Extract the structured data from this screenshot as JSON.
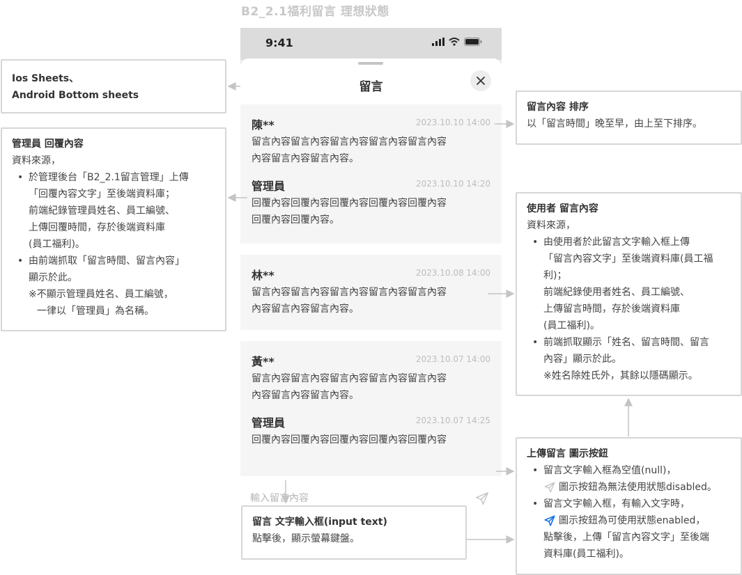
{
  "page_title": "B2_2.1福利留言 理想狀態",
  "status_bar": {
    "time": "9:41"
  },
  "sheet": {
    "title": "留言",
    "close_icon": "close-icon"
  },
  "messages": [
    {
      "name": "陳**",
      "time": "2023.10.10 14:00",
      "body_line1": "留言內容留言內容留言內容留言內容留言內容",
      "body_line2": "內容留言內容留言內容。",
      "reply": {
        "name": "管理員",
        "time": "2023.10.10 14:20",
        "body_line1": "回覆內容回覆內容回覆內容回覆內容回覆內容",
        "body_line2": "回覆內容回覆內容。"
      }
    },
    {
      "name": "林**",
      "time": "2023.10.08 14:00",
      "body_line1": "留言內容留言內容留言內容留言內容留言內容",
      "body_line2": "內容留言內容留言內容。"
    },
    {
      "name": "黃**",
      "time": "2023.10.07 14:00",
      "body_line1": "留言內容留言內容留言內容留言內容留言內容",
      "body_line2": "內容留言內容留言內容。",
      "reply": {
        "name": "管理員",
        "time": "2023.10.07 14:25",
        "body_line1": "回覆內容回覆內容回覆內容回覆內容回覆內容",
        "body_line2": ""
      }
    }
  ],
  "input": {
    "placeholder": "輸入留言內容",
    "send_icon": "send-icon"
  },
  "notes": {
    "sheets": {
      "line1": "Ios Sheets、",
      "line2": "Android Bottom sheets"
    },
    "admin": {
      "title": "管理員 回覆內容",
      "source": "資料來源，",
      "b1_l1": "於管理後台「B2_2.1留言管理」上傳",
      "b1_l2": "「回覆內容文字」至後端資料庫；",
      "b1_l3": "前端紀錄管理員姓名、員工編號、",
      "b1_l4": "上傳回覆時間，存於後端資料庫",
      "b1_l5": "(員工福利)。",
      "b2_l1": "由前端抓取「留言時間、留言內容」",
      "b2_l2": "顯示於此。",
      "b2_l3": "※不顯示管理員姓名、員工編號，",
      "b2_l4": "一律以「管理員」為名稱。"
    },
    "sort": {
      "title": "留言內容 排序",
      "text": "以「留言時間」晚至早，由上至下排序。"
    },
    "user": {
      "title": "使用者 留言內容",
      "source": "資料來源，",
      "b1_l1": "由使用者於此留言文字輸入框上傳",
      "b1_l2": "「留言內容文字」至後端資料庫(員工福",
      "b1_l3": "利)；",
      "b1_l4": "前端紀錄使用者姓名、員工編號、",
      "b1_l5": "上傳留言時間，存於後端資料庫",
      "b1_l6": "(員工福利)。",
      "b2_l1": "前端抓取顯示「姓名、留言時間、留言",
      "b2_l2": "內容」顯示於此。",
      "b2_l3": "※姓名除姓氏外，其餘以隱碼顯示。"
    },
    "upload": {
      "title": "上傳留言 圖示按鈕",
      "b1_l1": "留言文字輸入框為空值(null)，",
      "b1_l2": "圖示按鈕為無法使用狀態disabled。",
      "b2_l1": "留言文字輸入框，有輸入文字時，",
      "b2_l2": "圖示按鈕為可使用狀態enabled，",
      "b2_l3": "點擊後，上傳「留言內容文字」至後端",
      "b2_l4": "資料庫(員工福利)。"
    },
    "input": {
      "title": "留言 文字輸入框(input text)",
      "text": "點擊後，顯示螢幕鍵盤。"
    }
  },
  "colors": {
    "send_disabled": "#c4c4c4",
    "send_enabled": "#1a73e8",
    "annotation_border": "#d6d6d6"
  }
}
